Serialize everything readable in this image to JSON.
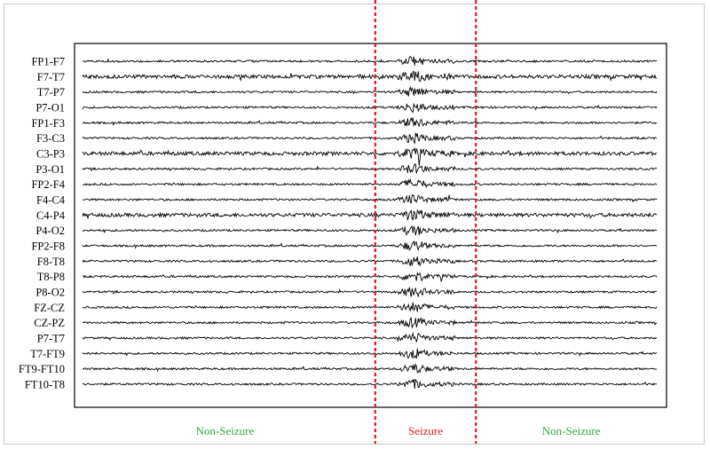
{
  "chart_data": {
    "type": "line",
    "title": "",
    "xlabel": "",
    "ylabel": "",
    "channels": [
      "FP1-F7",
      "F7-T7",
      "T7-P7",
      "P7-O1",
      "FP1-F3",
      "F3-C3",
      "C3-P3",
      "P3-O1",
      "FP2-F4",
      "F4-C4",
      "C4-P4",
      "P4-O2",
      "FP2-F8",
      "F8-T8",
      "T8-P8",
      "P8-O2",
      "FZ-CZ",
      "CZ-PZ",
      "P7-T7",
      "T7-FT9",
      "FT9-FT10",
      "FT10-T8"
    ],
    "regions": [
      {
        "label": "Non-Seizure",
        "start": 0.0,
        "end": 0.508,
        "color": "#2eaa45"
      },
      {
        "label": "Seizure",
        "start": 0.508,
        "end": 0.678,
        "color": "#e11b1b"
      },
      {
        "label": "Non-Seizure",
        "start": 0.678,
        "end": 1.0,
        "color": "#2eaa45"
      }
    ],
    "boundary_color": "#e11b1b",
    "trace_color": "#000000",
    "grid": false,
    "legend": "none"
  }
}
